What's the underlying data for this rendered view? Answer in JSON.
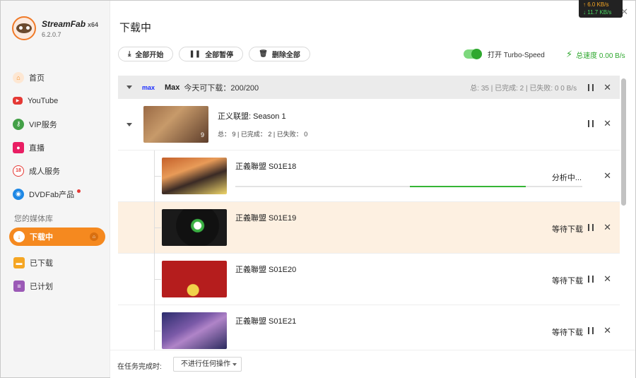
{
  "app": {
    "name": "StreamFab",
    "arch": "x64",
    "version": "6.2.0.7"
  },
  "speed_popup": {
    "upload": "↑ 6.0 KB/s",
    "download": "↓ 11.7 KB/s"
  },
  "sidebar": {
    "items": [
      {
        "label": "首页",
        "icon": "home-icon",
        "color": "#f5891f"
      },
      {
        "label": "YouTube",
        "icon": "youtube-icon",
        "color": "#e53935"
      },
      {
        "label": "VIP服务",
        "icon": "vip-key-icon",
        "color": "#43a047"
      },
      {
        "label": "直播",
        "icon": "live-video-icon",
        "color": "#e91e63"
      },
      {
        "label": "成人服务",
        "icon": "adult-18-icon",
        "color": "#e53935"
      },
      {
        "label": "DVDFab产品",
        "icon": "dvdfab-icon",
        "color": "#1e88e5"
      }
    ],
    "library_title": "您的媒体库",
    "library": [
      {
        "label": "下载中",
        "icon": "download-icon",
        "active": true
      },
      {
        "label": "已下载",
        "icon": "folder-icon",
        "color": "#f5891f"
      },
      {
        "label": "已计划",
        "icon": "schedule-icon",
        "color": "#8e44ad"
      }
    ]
  },
  "main": {
    "title": "下载中",
    "toolbar": {
      "start_all": "全部开始",
      "pause_all": "全部暂停",
      "delete_all": "删除全部"
    },
    "turbo_label": "打开 Turbo-Speed",
    "total_speed": "总速度 0.00 B/s"
  },
  "group": {
    "logo": "max",
    "name": "Max",
    "quota": "今天可下载：200/200",
    "stats": "总: 35 | 已完成: 2 | 已失败: 0    0 B/s",
    "season": {
      "title": "正义联盟: Season 1",
      "count_badge": "9",
      "stats": "总： 9 | 已完成： 2 | 已失败： 0"
    },
    "episodes": [
      {
        "title": "正義聯盟 S01E18",
        "status": "分析中...",
        "progress_start": 0.503,
        "progress_end": 0.838,
        "active": false
      },
      {
        "title": "正義聯盟 S01E19",
        "status": "等待下载",
        "active": true
      },
      {
        "title": "正義聯盟 S01E20",
        "status": "等待下载",
        "active": false
      },
      {
        "title": "正義聯盟 S01E21",
        "status": "等待下载",
        "active": false
      }
    ]
  },
  "footer": {
    "label": "在任务完成时:",
    "select_value": "不进行任何操作"
  }
}
